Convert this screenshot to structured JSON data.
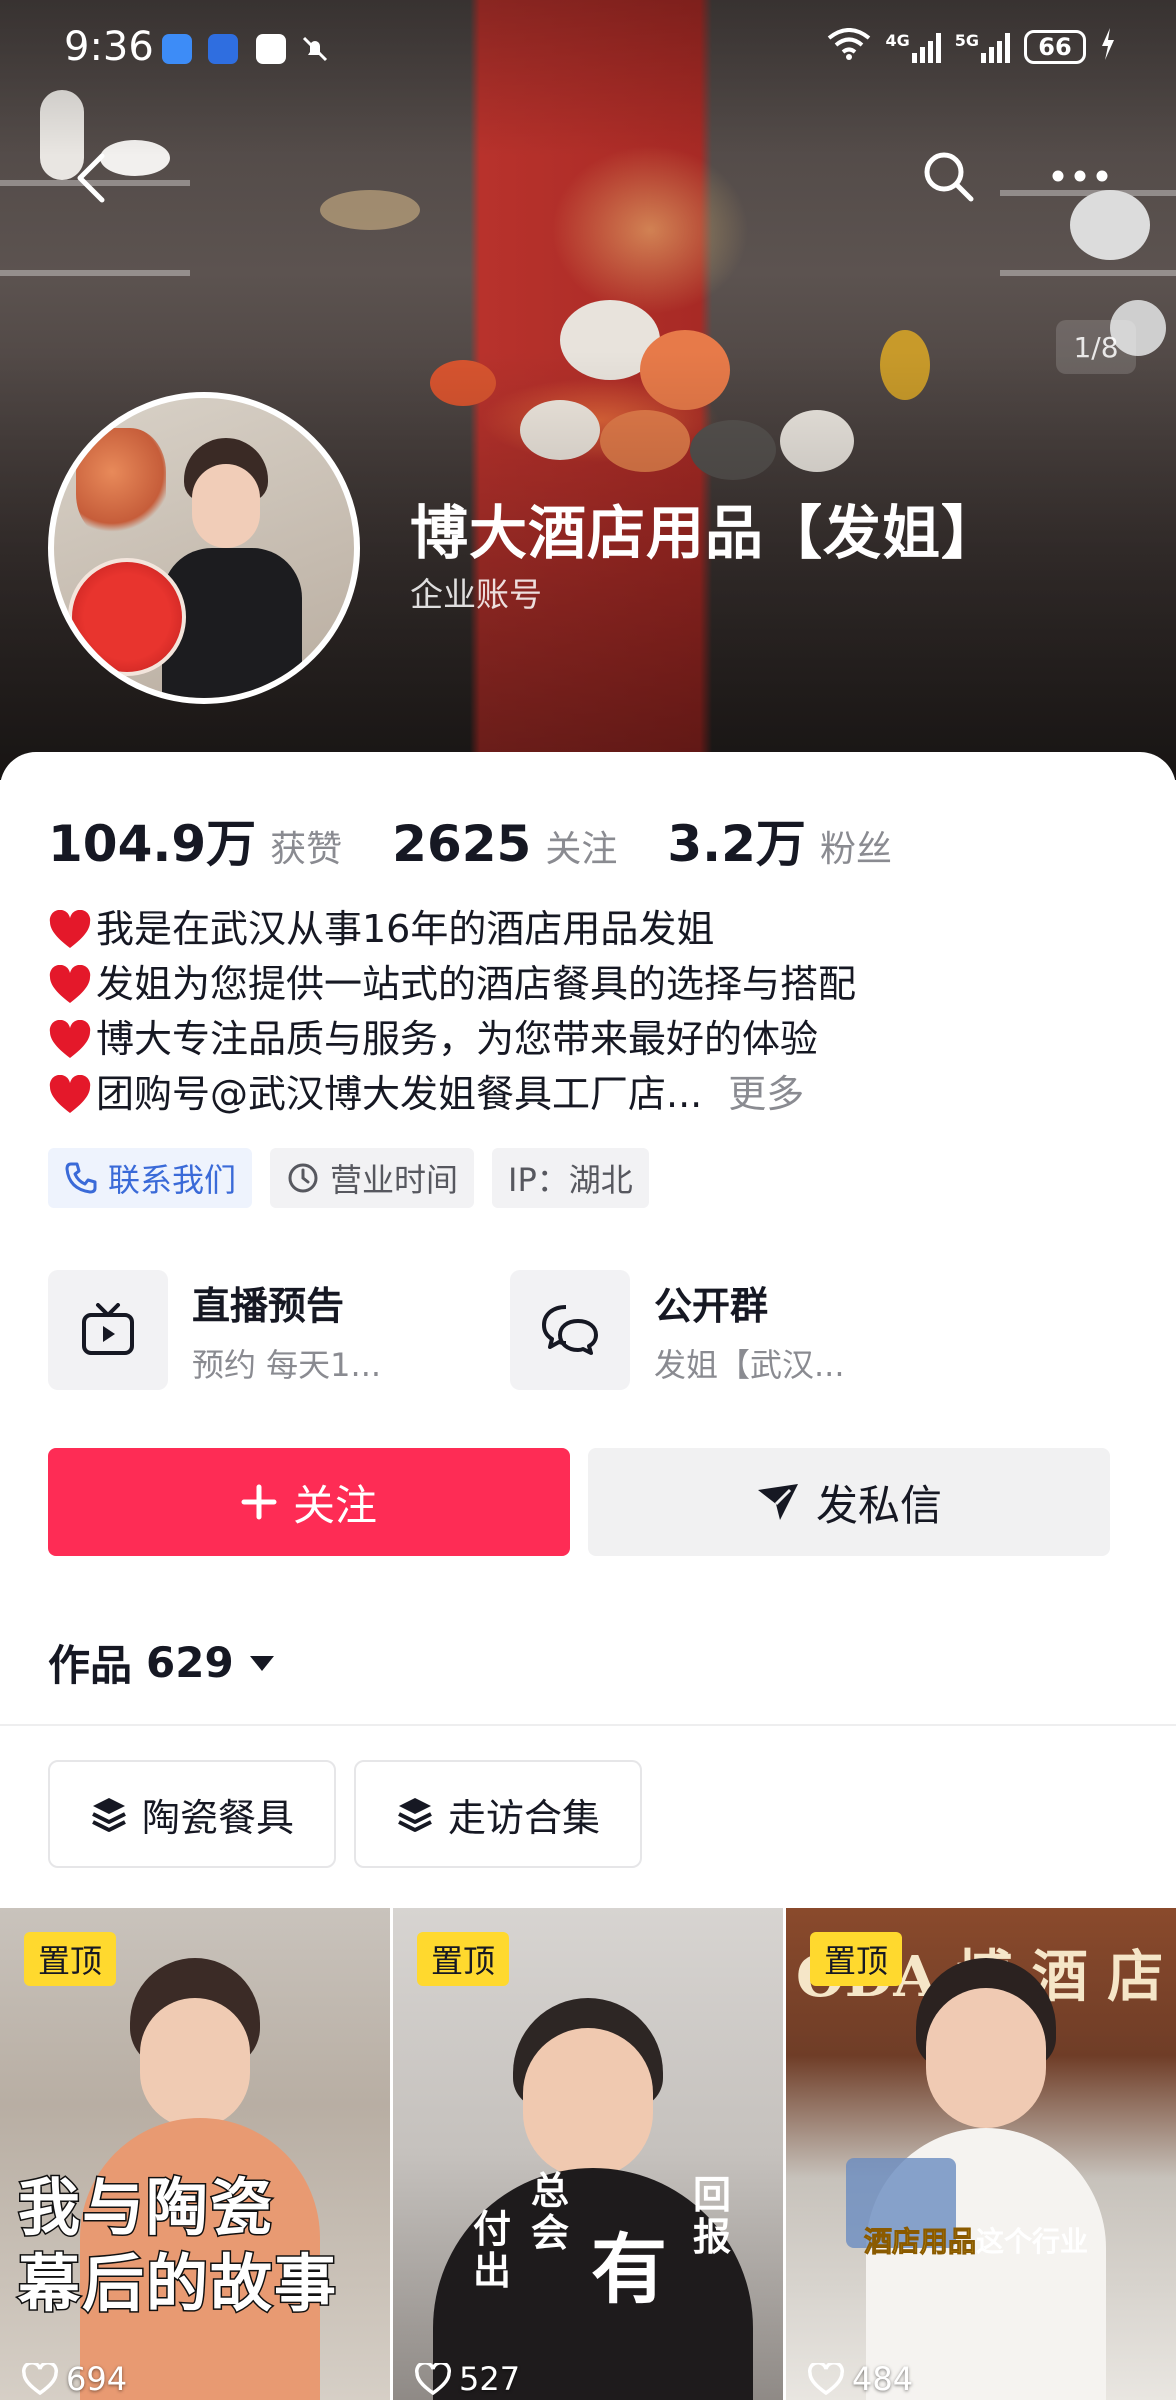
{
  "status_bar": {
    "time": "9:36",
    "net1": "4G",
    "net2": "5G",
    "battery": "66"
  },
  "header": {
    "image_counter": "1/8",
    "name": "博大酒店用品【发姐】",
    "account_type": "企业账号"
  },
  "stats": [
    {
      "value": "104.9万",
      "label": "获赞"
    },
    {
      "value": "2625",
      "label": "关注"
    },
    {
      "value": "3.2万",
      "label": "粉丝"
    }
  ],
  "bio": {
    "lines": [
      "我是在武汉从事16年的酒店用品发姐",
      "发姐为您提供一站式的酒店餐具的选择与搭配",
      "博大专注品质与服务，为您带来最好的体验",
      "团购号@武汉博大发姐餐具工厂店..."
    ],
    "more": "更多"
  },
  "tags": {
    "contact": "联系我们",
    "hours": "营业时间",
    "ip": "IP：湖北"
  },
  "features": [
    {
      "title": "直播预告",
      "subtitle": "预约 每天1...",
      "icon": "tv-icon"
    },
    {
      "title": "公开群",
      "subtitle": "发姐【武汉...",
      "icon": "chat-bubbles-icon"
    }
  ],
  "actions": {
    "follow": "关注",
    "message": "发私信"
  },
  "works": {
    "label": "作品",
    "count": "629"
  },
  "collections": [
    "陶瓷餐具",
    "走访合集"
  ],
  "videos": [
    {
      "pin": "置顶",
      "likes": "694",
      "caption": [
        "我与陶瓷",
        "幕后的故事"
      ]
    },
    {
      "pin": "置顶",
      "likes": "527",
      "calligraphy": [
        "付出",
        "总会",
        "有",
        "回报"
      ]
    },
    {
      "pin": "置顶",
      "likes": "484",
      "caption_yellow": "酒店用品",
      "caption_white": "这个行业",
      "sign_text": "ODA 博 酒 店"
    }
  ],
  "colors": {
    "accent": "#fe2c55",
    "pin": "#ffd92e",
    "link": "#3a6ad8"
  }
}
